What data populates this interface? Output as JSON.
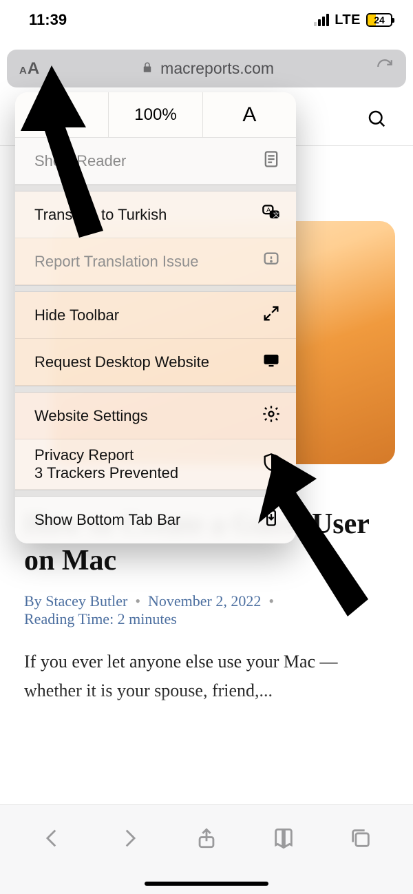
{
  "status": {
    "time": "11:39",
    "network": "LTE",
    "battery_pct": "24"
  },
  "address": {
    "domain": "macreports.com"
  },
  "popover": {
    "zoom_pct": "100%",
    "show_reader": "Show Reader",
    "translate": "Translate to Turkish",
    "report_translation": "Report Translation Issue",
    "hide_toolbar": "Hide Toolbar",
    "request_desktop": "Request Desktop Website",
    "website_settings": "Website Settings",
    "privacy_report": "Privacy Report",
    "privacy_sub": "3 Trackers Prevented",
    "show_bottom_tab": "Show Bottom Tab Bar"
  },
  "article": {
    "title": "How to Create a Guest User on Mac",
    "by_prefix": "By ",
    "author": "Stacey Butler",
    "date": "November 2, 2022",
    "reading_time": "Reading Time: 2 minutes",
    "excerpt": "If you ever let anyone else use your Mac — whether it is your spouse, friend,..."
  }
}
